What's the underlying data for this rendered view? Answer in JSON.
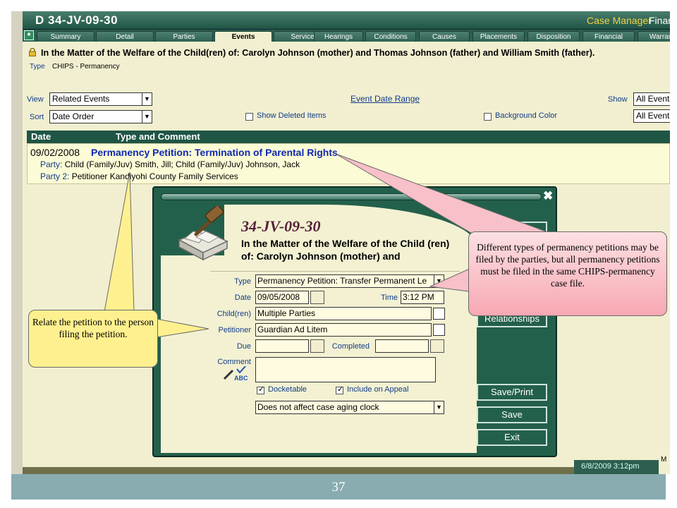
{
  "window": {
    "case_number": "34-JV-09-30",
    "menu_case_manager": "Case Manager",
    "menu_financial_partial": "Finan"
  },
  "tabs": [
    "Summary",
    "Detail",
    "Parties",
    "Events",
    "Service",
    "Hearings",
    "Conditions",
    "Causes",
    "Placements",
    "Disposition",
    "Financial",
    "Warrants"
  ],
  "active_tab": "Events",
  "case": {
    "matter_title": "In the Matter of the Welfare of the Child(ren) of: Carolyn Johnson (mother) and Thomas Johnson (father) and William Smith (father).",
    "type_label": "Type",
    "type_value": "CHIPS - Permanency"
  },
  "filters": {
    "view_label": "View",
    "view_value": "Related Events",
    "sort_label": "Sort",
    "sort_value": "Date Order",
    "event_date_range": "Event Date Range",
    "show_deleted": "Show Deleted Items",
    "background_color": "Background Color",
    "show_label": "Show",
    "show_value_1": "All Event Gr",
    "show_value_2": "All Events"
  },
  "grid": {
    "col_date": "Date",
    "col_type": "Type and Comment",
    "event": {
      "date": "09/02/2008",
      "title": "Permanency Petition: Termination of Parental Rights",
      "party_label": "Party:",
      "party_value": "Child (Family/Juv)   Smith, Jill; Child (Family/Juv)   Johnson, Jack",
      "party2_label": "Party 2:",
      "party2_value": "Petitioner   Kandiyohi County Family Services"
    }
  },
  "status": {
    "timestamp": "6/8/2009 3:12pm",
    "mode": "M"
  },
  "dialog": {
    "close": "✖",
    "case_number": "34-JV-09-30",
    "matter": "In the Matter of the Welfare of the Child (ren) of: Carolyn Johnson (mother) and",
    "type_label": "Type",
    "type_value": "Permanency Petition: Transfer Permanent Le",
    "date_label": "Date",
    "date_value": "09/05/2008",
    "time_label": "Time",
    "time_value": "3:12 PM",
    "children_label": "Child(ren)",
    "children_value": "Multiple Parties",
    "petitioner_label": "Petitioner",
    "petitioner_value": "Guardian Ad Litem",
    "due_label": "Due",
    "due_value": "",
    "completed_label": "Completed",
    "completed_value": "",
    "comment_label": "Comment",
    "comment_value": "",
    "docketable": "Docketable",
    "include_on_appeal": "Include on Appeal",
    "aging_value": "Does not affect case aging clock",
    "relationships_button": "Relationships",
    "save_print_button": "Save/Print",
    "save_button": "Save",
    "exit_button": "Exit"
  },
  "callouts": {
    "left": "Relate the petition to the person filing the petition.",
    "right": "Different types of permanency petitions may be filed by the parties, but all permanency petitions must be filed in the same CHIPS-permanency case file."
  },
  "slide": {
    "page_number": "37"
  },
  "colors": {
    "title_bar": "#1f5545",
    "accent_gold": "#f5d142",
    "panel_cream": "#f1efd0",
    "link_blue": "#123c8a",
    "event_title_blue": "#1028b0",
    "callout_yellow": "#fff08f",
    "callout_pink": "#f7a8b2",
    "footer_teal": "#89acb0"
  }
}
